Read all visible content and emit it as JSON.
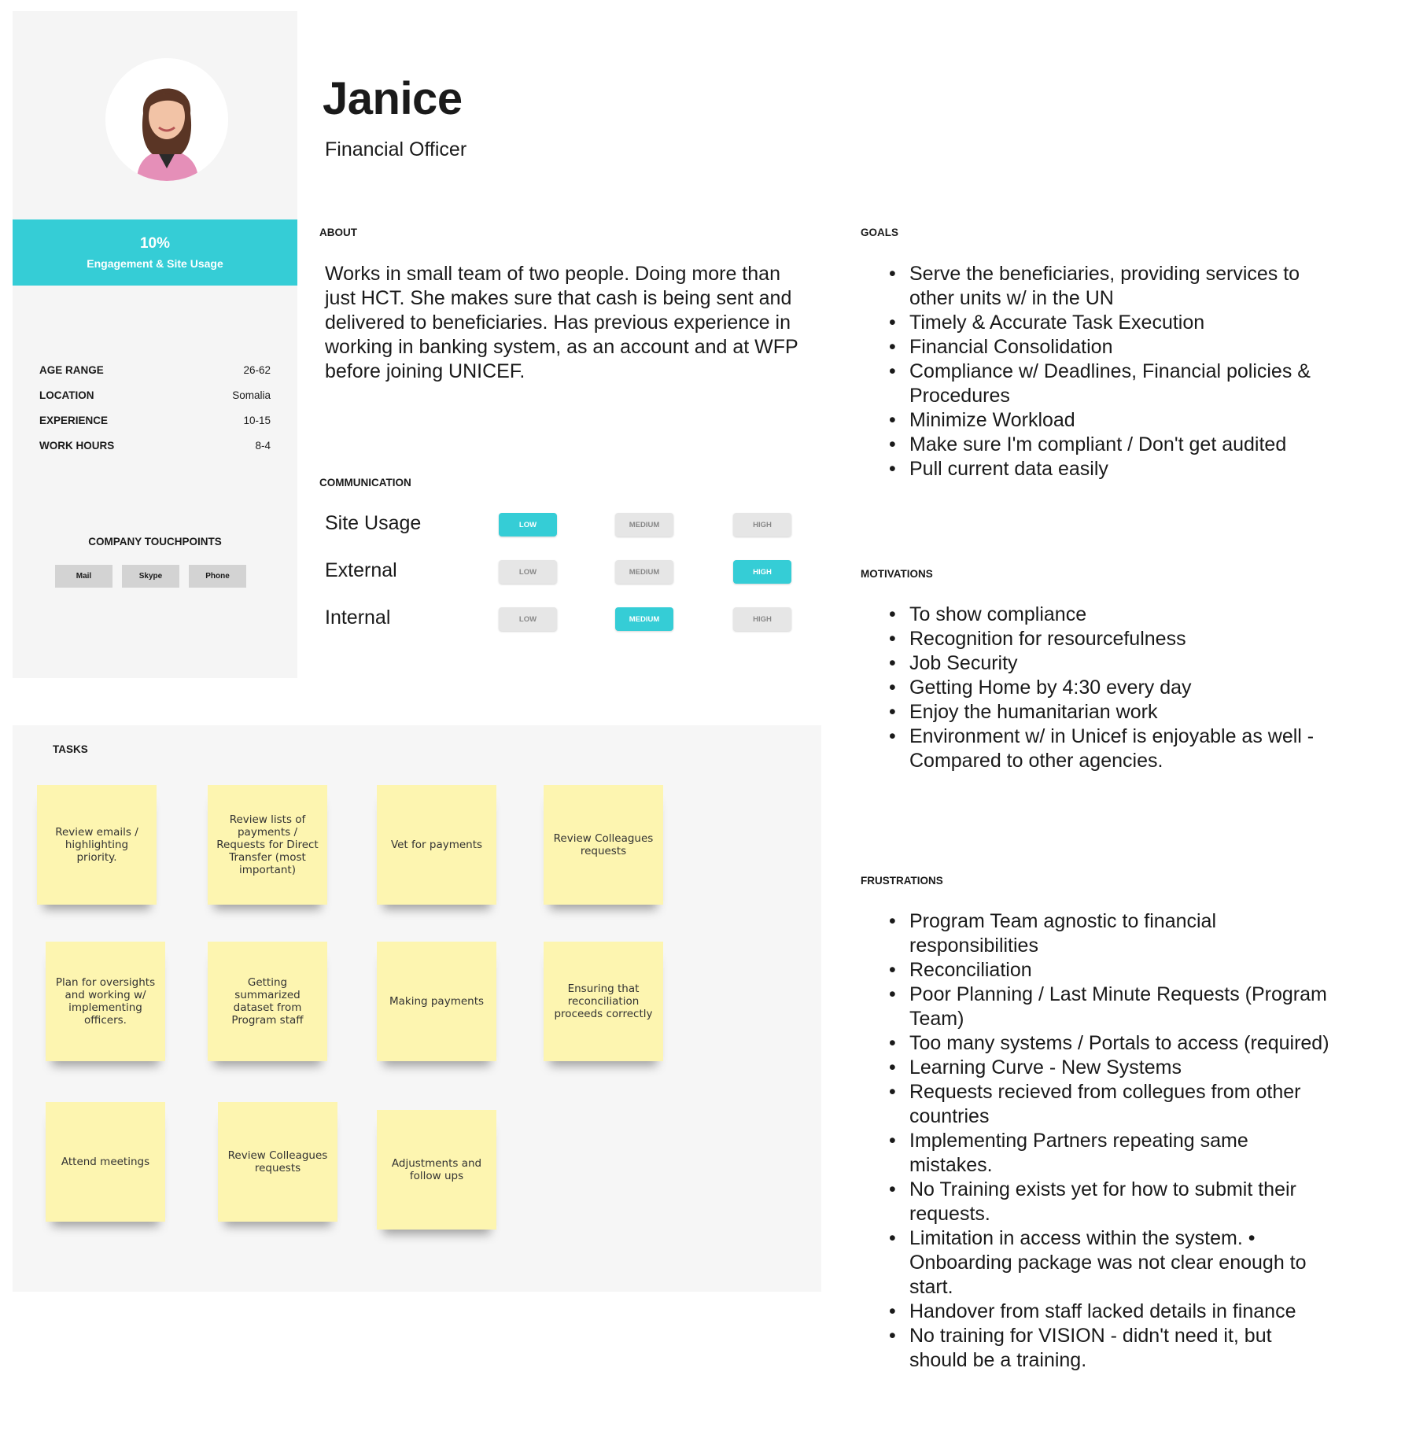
{
  "persona": {
    "name": "Janice",
    "role": "Financial Officer"
  },
  "engagement": {
    "percent": "10%",
    "caption": "Engagement & Site Usage"
  },
  "stats": [
    {
      "label": "AGE RANGE",
      "value": "26-62"
    },
    {
      "label": "LOCATION",
      "value": "Somalia"
    },
    {
      "label": "EXPERIENCE",
      "value": "10-15"
    },
    {
      "label": "WORK HOURS",
      "value": "8-4"
    }
  ],
  "touchpoints": {
    "title": "COMPANY TOUCHPOINTS",
    "items": [
      "Mail",
      "Skype",
      "Phone"
    ]
  },
  "about": {
    "label": "ABOUT",
    "text": "Works in small team of two people. Doing more than just HCT. She makes sure that cash is being sent and delivered to beneficiaries. Has previous experience in working in banking system, as an account and at WFP before joining UNICEF."
  },
  "communication": {
    "label": "COMMUNICATION",
    "levels": [
      "LOW",
      "MEDIUM",
      "HIGH"
    ],
    "rows": [
      {
        "label": "Site Usage",
        "selected": "LOW"
      },
      {
        "label": "External",
        "selected": "HIGH"
      },
      {
        "label": "Internal",
        "selected": "MEDIUM"
      }
    ],
    "active_color": "#35cdd6"
  },
  "goals": {
    "label": "GOALS",
    "items": [
      "Serve the beneficiaries, providing services to other units w/ in the UN",
      "Timely & Accurate Task Execution",
      "Financial Consolidation",
      "Compliance w/ Deadlines, Financial policies & Procedures",
      "Minimize Workload",
      "Make sure I'm compliant / Don't get audited",
      "Pull current data easily"
    ]
  },
  "motivations": {
    "label": "MOTIVATIONS",
    "items": [
      "To show compliance",
      "Recognition for resourcefulness",
      "Job Security",
      "Getting Home by 4:30 every day",
      "Enjoy the humanitarian work",
      "Environment w/ in Unicef is enjoyable as well - Compared to other agencies."
    ]
  },
  "frustrations": {
    "label": "FRUSTRATIONS",
    "items": [
      "Program Team agnostic to financial responsibilities",
      "Reconciliation",
      "Poor Planning / Last Minute Requests (Program Team)",
      "Too many systems / Portals to access (required)",
      "Learning Curve - New Systems",
      "Requests recieved from collegues from other countries",
      "Implementing Partners repeating same mistakes.",
      "No Training exists yet for how to submit their requests.",
      "Limitation in access within the system. • Onboarding package was not clear enough to start.",
      "Handover from staff lacked details in finance",
      "No training for VISION - didn't need it, but should be a training."
    ]
  },
  "tasks": {
    "label": "TASKS",
    "notes": [
      "Review emails / highlighting priority.",
      "Review lists of payments / Requests for Direct Transfer (most important)",
      "Vet for payments",
      "Review Colleagues requests",
      "Plan for oversights and working w/ implementing officers.",
      "Getting summarized dataset from Program staff",
      "Making payments",
      "Ensuring that reconciliation proceeds correctly",
      "Attend meetings",
      "Review Colleagues requests",
      "Adjustments and follow ups"
    ],
    "note_color": "#fdf5b0"
  }
}
